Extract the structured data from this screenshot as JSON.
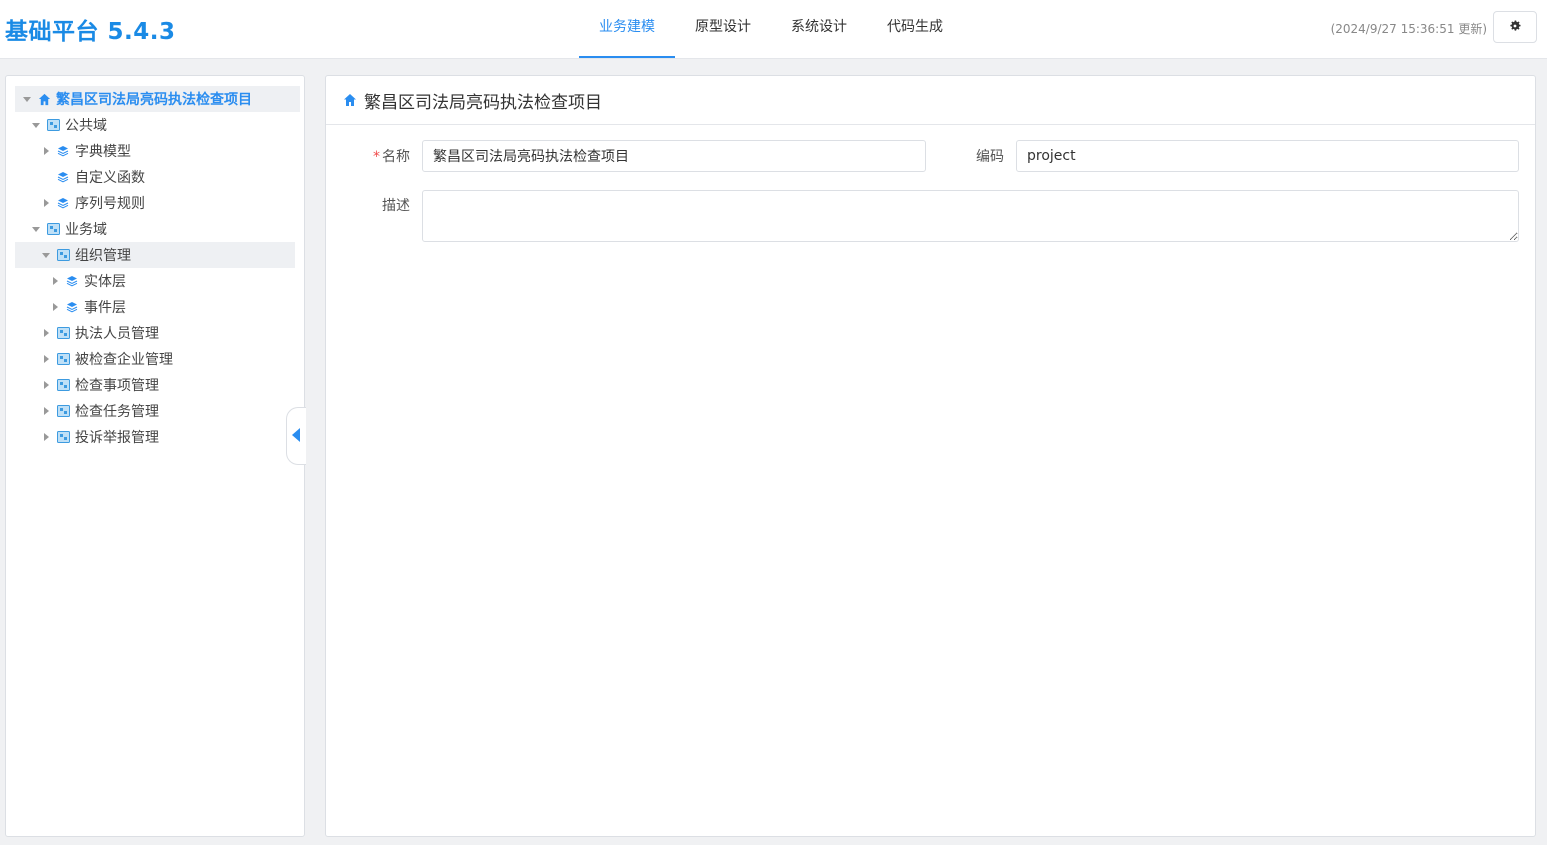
{
  "app": {
    "title": "基础平台 5.4.3"
  },
  "nav": {
    "tabs": [
      {
        "label": "业务建模",
        "active": true
      },
      {
        "label": "原型设计",
        "active": false
      },
      {
        "label": "系统设计",
        "active": false
      },
      {
        "label": "代码生成",
        "active": false
      }
    ],
    "update_time": "(2024/9/27 15:36:51 更新)"
  },
  "colors": {
    "accent": "#2a8df0",
    "brand": "#1a8ae5",
    "required": "#f04a4a"
  },
  "tree": {
    "root": "繁昌区司法局亮码执法检查项目",
    "public_domain": "公共域",
    "public_children": [
      "字典模型",
      "自定义函数",
      "序列号规则"
    ],
    "business_domain": "业务域",
    "org_mgmt": "组织管理",
    "org_children": [
      "实体层",
      "事件层"
    ],
    "business_children": [
      "执法人员管理",
      "被检查企业管理",
      "检查事项管理",
      "检查任务管理",
      "投诉举报管理"
    ]
  },
  "main": {
    "title": "繁昌区司法局亮码执法检查项目",
    "form": {
      "name_label": "名称",
      "name_required_mark": "*",
      "name_value": "繁昌区司法局亮码执法检查项目",
      "code_label": "编码",
      "code_value": "project",
      "desc_label": "描述",
      "desc_value": ""
    }
  }
}
